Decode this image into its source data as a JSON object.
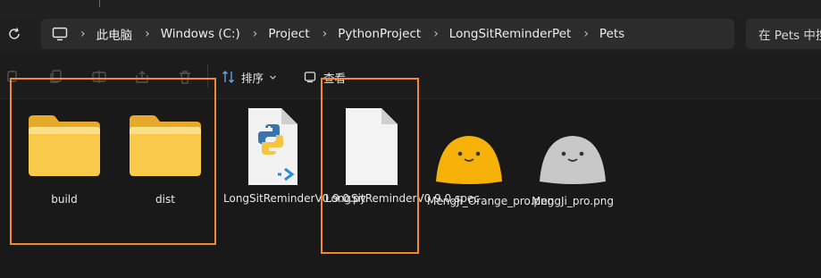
{
  "breadcrumb": {
    "items": [
      "此电脑",
      "Windows (C:)",
      "Project",
      "PythonProject",
      "LongSitReminderPet",
      "Pets"
    ]
  },
  "search": {
    "placeholder": "在 Pets 中搜"
  },
  "toolbar": {
    "sort_label": "排序",
    "view_label": "查看"
  },
  "files": [
    {
      "name": "build",
      "type": "folder"
    },
    {
      "name": "dist",
      "type": "folder"
    },
    {
      "name": "LongSitReminderV0.9.0.py",
      "type": "python"
    },
    {
      "name": "LongSitReminderV0.9.0.spec",
      "type": "document"
    },
    {
      "name": "MengJi_Orange_pro.png",
      "type": "image-orange"
    },
    {
      "name": "MengJi_pro.png",
      "type": "image-gray"
    }
  ],
  "colors": {
    "highlight": "#f28a2c",
    "folder": "#f9c94a",
    "orange_pet": "#f7b20a",
    "gray_pet": "#c8c8c8"
  }
}
